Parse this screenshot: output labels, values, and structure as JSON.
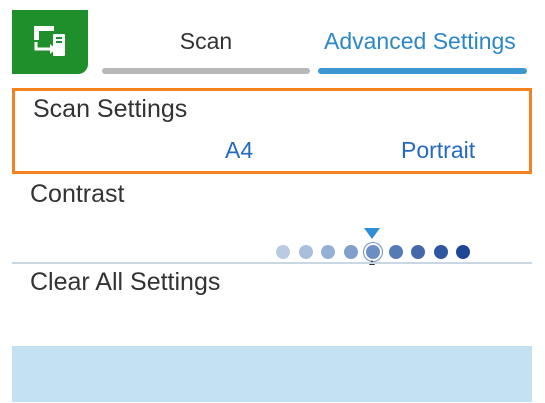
{
  "header": {
    "tabs": [
      {
        "label": "Scan",
        "active": false
      },
      {
        "label": "Advanced Settings",
        "active": true
      }
    ],
    "app_icon": "scan-to-computer-icon"
  },
  "settings": {
    "scan_settings": {
      "label": "Scan Settings",
      "paper_size": "A4",
      "orientation": "Portrait"
    },
    "contrast": {
      "label": "Contrast",
      "level_index": 4,
      "level_count": 9
    },
    "clear_all": {
      "label": "Clear All Settings"
    }
  },
  "colors": {
    "app_icon_bg": "#1e8f2a",
    "active_tab": "#2b87c8",
    "selected_border": "#f5811f",
    "value_text": "#2569c2",
    "footer_bg": "#c3e1f2",
    "contrast_dots": [
      "#b9cbe2",
      "#a9bfdd",
      "#95b0d5",
      "#809fcb",
      "#6d8ec2",
      "#567ab6",
      "#4469ab",
      "#2f579f",
      "#1d4794"
    ]
  }
}
